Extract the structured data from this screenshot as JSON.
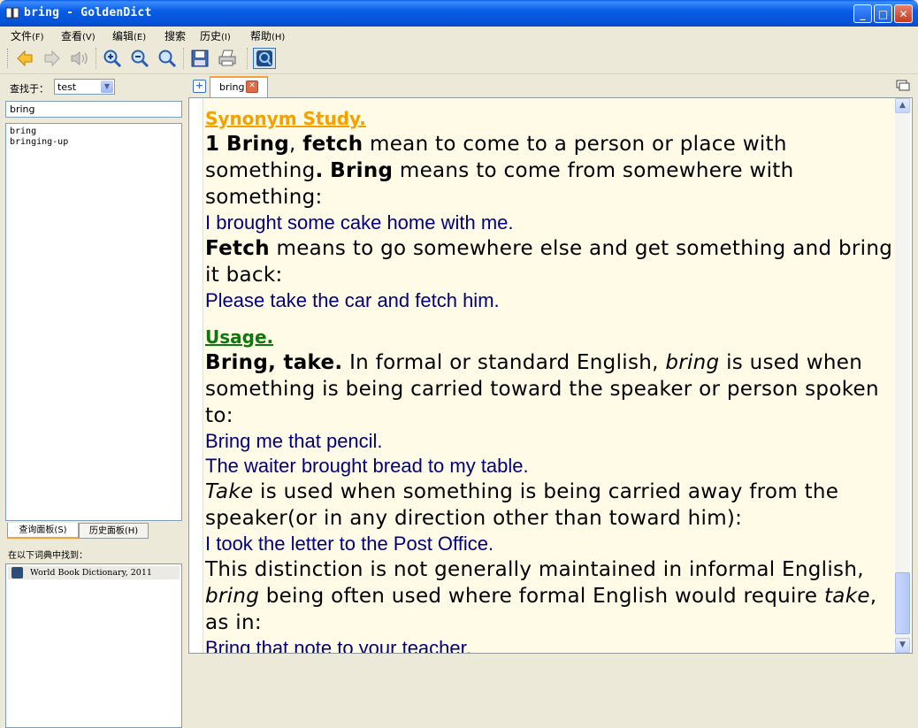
{
  "window": {
    "title": "bring - GoldenDict",
    "buttons": {
      "minimize": "_",
      "maximize": "□",
      "close": "✕"
    }
  },
  "menu": [
    {
      "label": "文件",
      "accel": "(F)"
    },
    {
      "label": "查看",
      "accel": "(V)"
    },
    {
      "label": "编辑",
      "accel": "(E)"
    },
    {
      "label": "搜索",
      "accel": ""
    },
    {
      "label": "历史",
      "accel": "(I)"
    },
    {
      "label": "帮助",
      "accel": "(H)"
    }
  ],
  "toolbar": {
    "icons": [
      "back-icon",
      "forward-icon",
      "pronounce-icon",
      "zoom-in-icon",
      "zoom-out-icon",
      "zoom-reset-icon",
      "save-icon",
      "print-icon",
      "scan-popup-icon"
    ]
  },
  "left": {
    "lookin_label": "查找于：",
    "group_value": "test",
    "search_value": "bring",
    "words": [
      "bring",
      "bringing-up"
    ],
    "tabs": {
      "search": "查询面板(S)",
      "history": "历史面板(H)"
    },
    "found_label": "在以下词典中找到：",
    "dictionaries": [
      "World Book Dictionary, 2011"
    ]
  },
  "article_tab": {
    "label": "bring",
    "close": "✕"
  },
  "article": {
    "synonym_heading": "Synonym Study.",
    "syn_p1": {
      "num": "1",
      "w1": "Bring",
      "comma": ",",
      "w2": "fetch",
      "t1": " mean to come to a person or place with something",
      "dot": ".",
      "w3": "Bring",
      "t2": " means to come from somewhere with something:"
    },
    "ex1": "I brought some cake home with me.",
    "syn_p2": {
      "w1": "Fetch",
      "t1": " means to go somewhere else and get something and bring it back:"
    },
    "ex2": "Please take the car and fetch him.",
    "usage_heading": "Usage.",
    "use_p1": {
      "w1": "Bring, take.",
      "t1": " In formal or standard English, ",
      "it1": "bring",
      "t2": " is used when something is being carried toward the speaker or person spoken to:"
    },
    "ex3": "Bring me that pencil.",
    "ex4": "The waiter brought bread to my table.",
    "use_p2": {
      "it1": "Take",
      "t1": " is used when something is being carried away from the speaker(or in any direction other than toward him):"
    },
    "ex5": "I took the letter to the Post Office.",
    "use_p3": {
      "t1": "This distinction is not generally maintained in informal English, ",
      "it1": "bring",
      "t2": " being often used where formal English would require ",
      "it2": "take",
      "t3": ", as in:"
    },
    "ex6": "Bring that note to your teacher."
  },
  "colors": {
    "titlebar": "#0a5de6",
    "synonym_heading": "#f6a000",
    "usage_heading": "#0a7a0a",
    "example_text": "#000080",
    "article_bg": "#fffbe6"
  }
}
